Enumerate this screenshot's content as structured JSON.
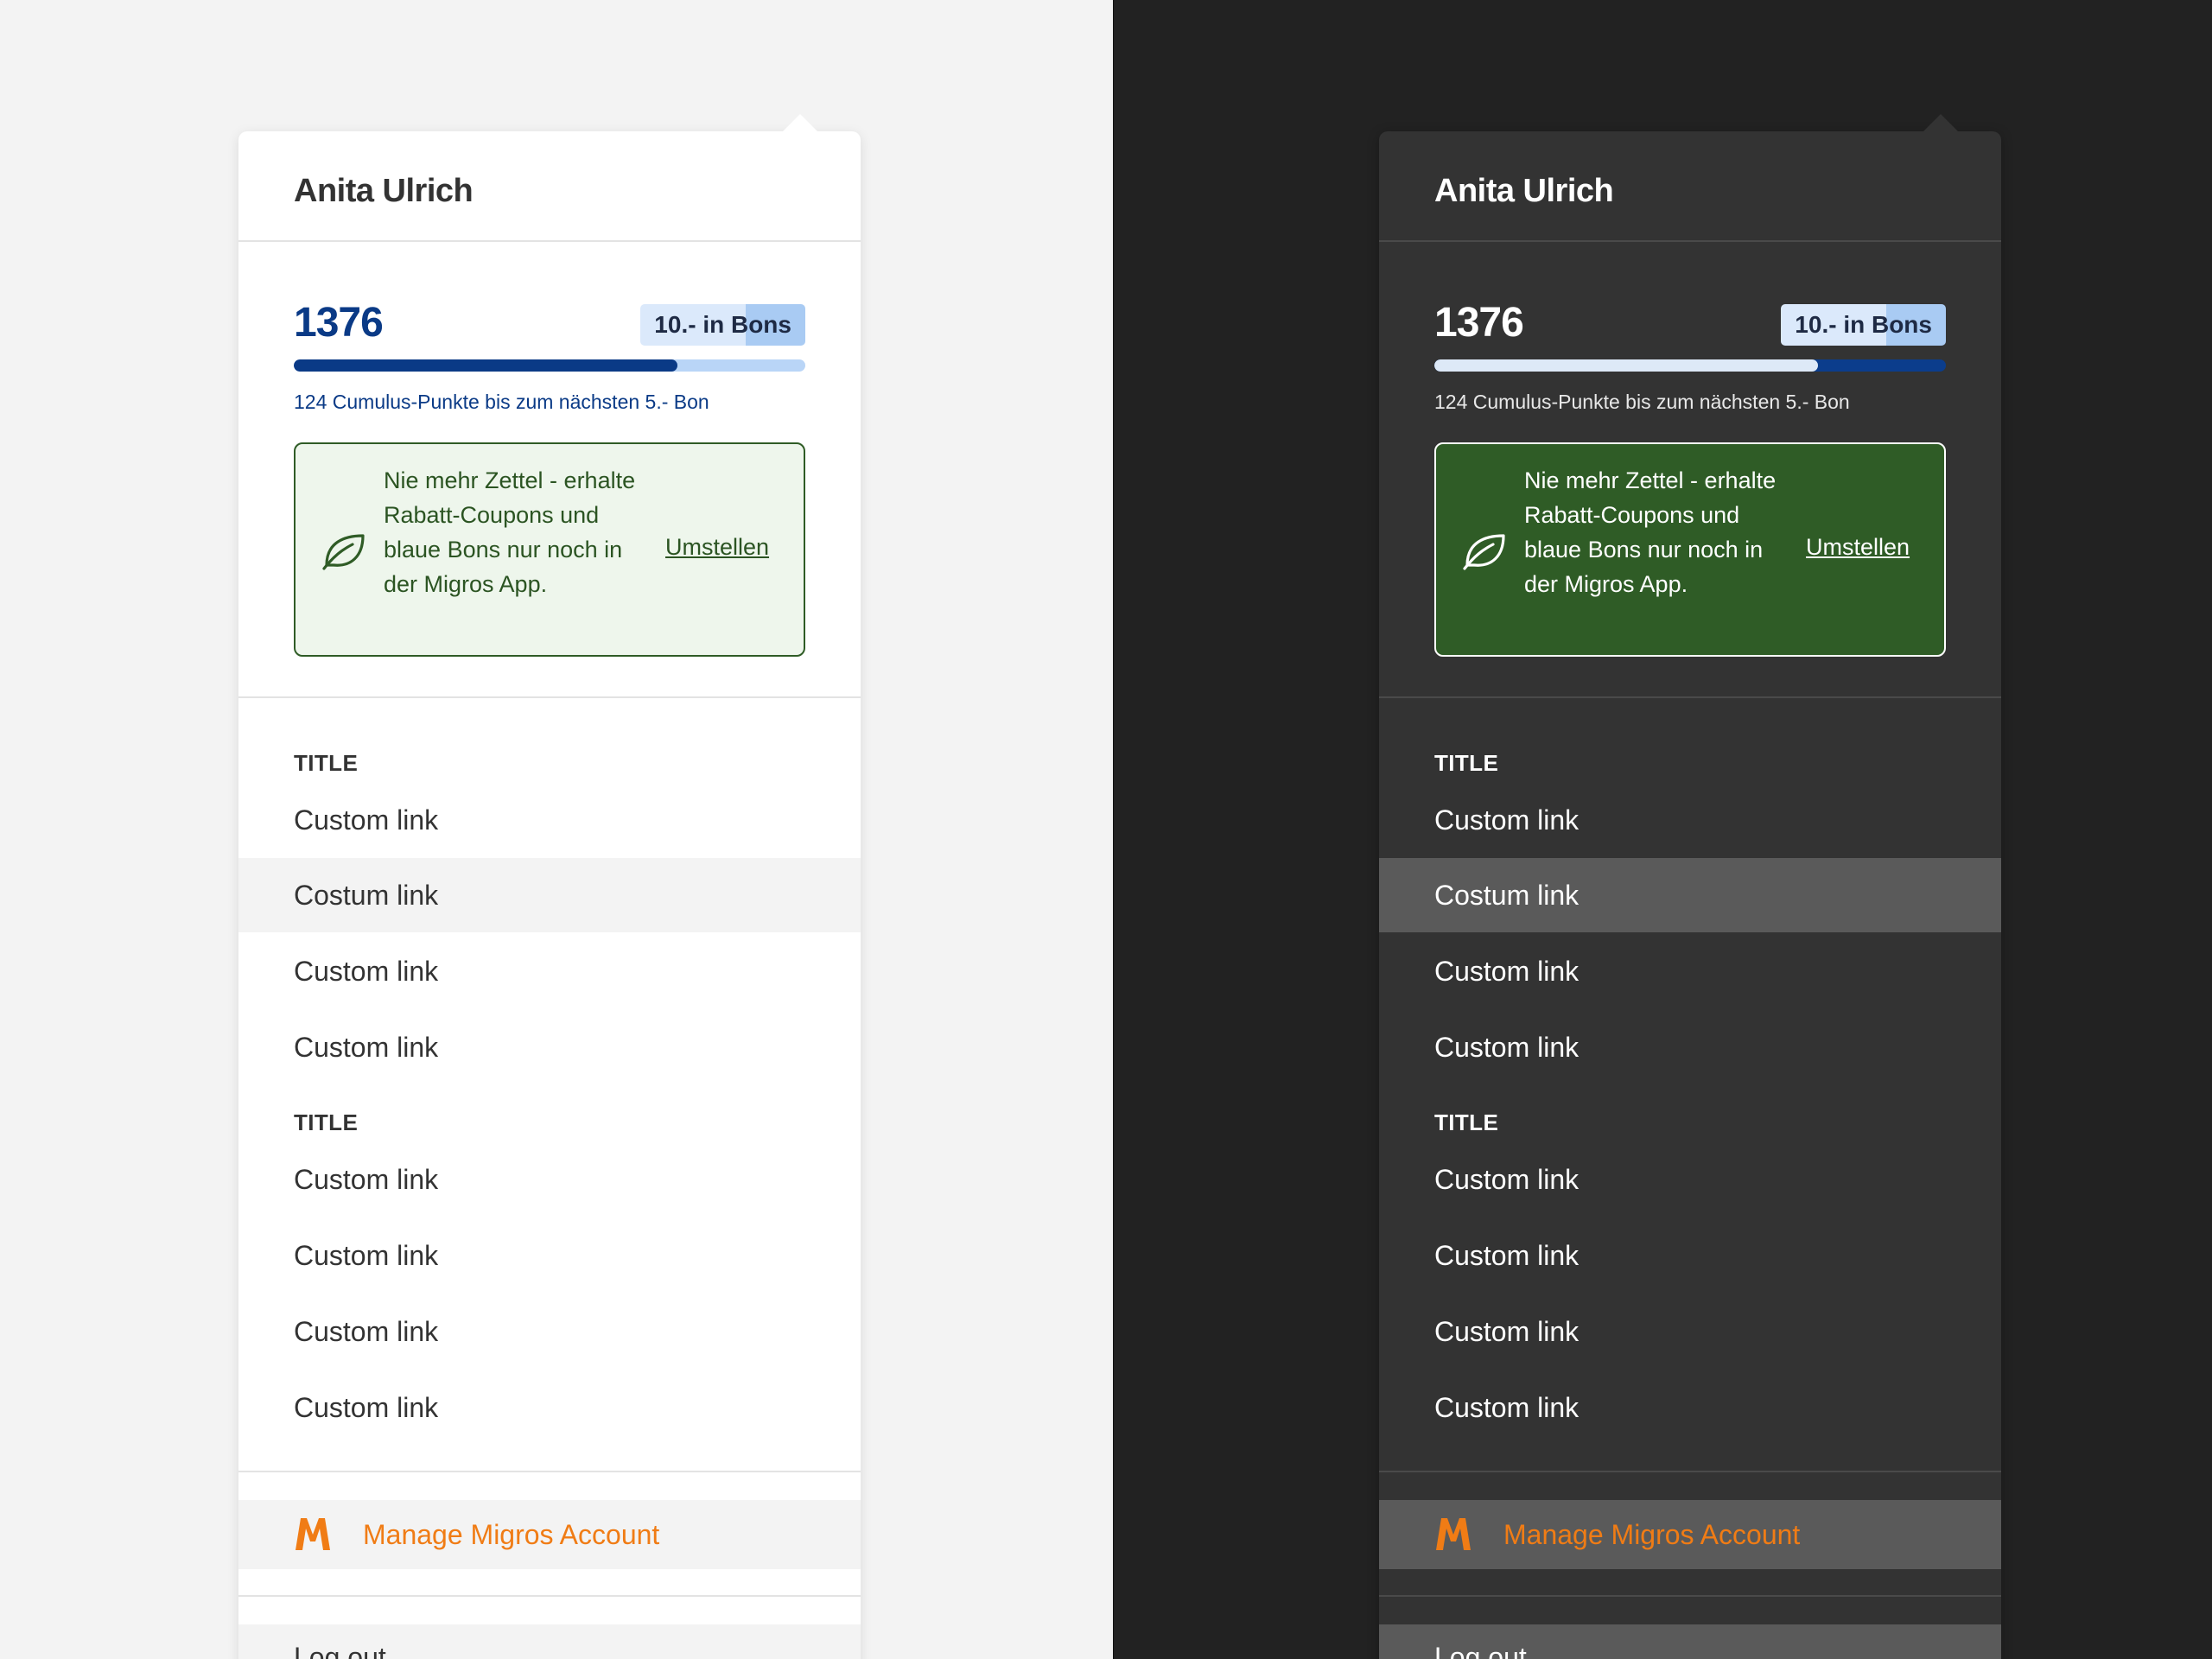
{
  "user": {
    "name": "Anita Ulrich"
  },
  "cumulus": {
    "points": "1376",
    "bonus_badge": "10.- in Bons",
    "progress_fraction": 0.75,
    "progress_text": "124 Cumulus-Punkte bis zum nächsten 5.- Bon"
  },
  "eco_notice": {
    "icon": "leaf-icon",
    "text": "Nie mehr Zettel - erhalte Rabatt-Coupons und blaue Bons nur noch in der Migros App.",
    "link_label": "Umstellen"
  },
  "nav": {
    "sections": [
      {
        "title": "TITLE",
        "links": [
          {
            "label": "Custom link",
            "hover": false
          },
          {
            "label": "Costum link",
            "hover": true
          },
          {
            "label": "Custom link",
            "hover": false
          },
          {
            "label": "Custom link",
            "hover": false
          }
        ]
      },
      {
        "title": "TITLE",
        "links": [
          {
            "label": "Custom link",
            "hover": false
          },
          {
            "label": "Custom link",
            "hover": false
          },
          {
            "label": "Custom link",
            "hover": false
          },
          {
            "label": "Custom link",
            "hover": false
          }
        ]
      }
    ]
  },
  "account": {
    "icon": "migros-m-icon",
    "label": "Manage Migros Account"
  },
  "logout": {
    "label": "Log out"
  },
  "themes": [
    "light",
    "dark"
  ],
  "colors": {
    "brand_orange": "#f07c15",
    "cumulus_blue": "#0a3a86",
    "eco_green": "#2f5c26",
    "light_background": "#f3f3f3",
    "dark_background": "#222222",
    "dark_panel": "#333333"
  }
}
